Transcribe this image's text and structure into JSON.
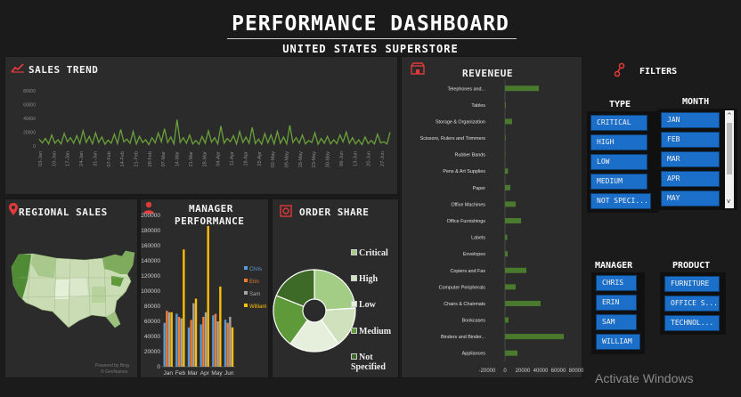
{
  "header": {
    "title": "PERFORMANCE DASHBOARD",
    "subtitle": "UNITED STATES SUPERSTORE"
  },
  "sales_trend": {
    "title": "SALES TREND",
    "y_ticks": [
      "80000",
      "60000",
      "40000",
      "20000",
      "0"
    ],
    "x_ticks": [
      "03-Jan",
      "10-Jan",
      "17-Jan",
      "24-Jan",
      "31-Jan",
      "07-Feb",
      "14-Feb",
      "21-Feb",
      "28-Feb",
      "07-Mar",
      "14-Mar",
      "21-Mar",
      "28-Mar",
      "04-Apr",
      "11-Apr",
      "18-Apr",
      "25-Apr",
      "02-May",
      "09-May",
      "16-May",
      "23-May",
      "30-May",
      "06-Jun",
      "13-Jun",
      "20-Jun",
      "27-Jun"
    ],
    "color": "#6aa03a"
  },
  "regional_sales": {
    "title": "REGIONAL SALES",
    "credit": "Powered by Bing\n© GeoNames"
  },
  "manager_performance": {
    "title_line1": "MANAGER",
    "title_line2": "PERFORMANCE"
  },
  "order_share": {
    "title": "ORDER SHARE",
    "legend": [
      "Critical",
      "High",
      "Low",
      "Medium",
      "Not Specified"
    ]
  },
  "revenue": {
    "title": "REVENEUE",
    "x_ticks": [
      "-20000",
      "0",
      "20000",
      "40000",
      "60000",
      "80000"
    ],
    "bar_color": "#4a7a2e"
  },
  "filters": {
    "title": "FILTERS",
    "type": {
      "title": "TYPE",
      "items": [
        "CRITICAL",
        "HIGH",
        "LOW",
        "MEDIUM",
        "NOT SPECI..."
      ]
    },
    "month": {
      "title": "MONTH",
      "items": [
        "JAN",
        "FEB",
        "MAR",
        "APR",
        "MAY"
      ]
    },
    "manager": {
      "title": "MANAGER",
      "items": [
        "CHRIS",
        "ERIN",
        "SAM",
        "WILLIAM"
      ]
    },
    "product": {
      "title": "PRODUCT",
      "items": [
        "FURNITURE",
        "OFFICE S...",
        "TECHNOL..."
      ]
    }
  },
  "watermark": "Activate Windows",
  "chart_data": [
    {
      "type": "line",
      "title": "SALES TREND",
      "ylim": [
        0,
        80000
      ],
      "x_range": [
        "03-Jan",
        "27-Jun"
      ],
      "series": [
        {
          "values": [
            10000,
            4500,
            11000,
            3000,
            16000,
            4000,
            9000,
            3000,
            18000,
            6000,
            12000,
            4000,
            15000,
            3500,
            22000,
            5000,
            14000,
            3000,
            19000,
            5000,
            13000,
            2500,
            8500,
            4000,
            17000,
            3500,
            24000,
            6000,
            10000,
            4000,
            21000,
            3000,
            14000,
            5000,
            9000,
            2000,
            12000,
            4500,
            19000,
            6000,
            25000,
            5000,
            13000,
            3000,
            38000,
            5000,
            12000,
            4000,
            16000,
            3000,
            8000,
            2500,
            14000,
            4000,
            22000,
            5500,
            12000,
            3000,
            29000,
            4000,
            11000,
            6000,
            15000,
            3000,
            21000,
            5000,
            13000,
            4000,
            27000,
            3500,
            10000,
            2500,
            18000,
            4500,
            16000,
            3000,
            21000,
            4000,
            13000,
            3000,
            30000,
            5000,
            12000,
            4000,
            16000,
            3000,
            8000,
            5000,
            19000,
            2500,
            11000,
            4000,
            14000,
            3000,
            9000,
            3500,
            16000,
            6000,
            20000,
            4000,
            12000,
            3000,
            9000,
            2000,
            13000,
            3500,
            8000,
            3000,
            17000,
            4500,
            6000,
            3000,
            20000
          ]
        }
      ]
    },
    {
      "type": "bar",
      "title": "MANAGER PERFORMANCE",
      "categories": [
        "Jan",
        "Feb",
        "Mar",
        "Apr",
        "May",
        "Jun"
      ],
      "ylim": [
        0,
        200000
      ],
      "y_ticks": [
        0,
        20000,
        40000,
        60000,
        80000,
        100000,
        120000,
        140000,
        160000,
        180000,
        200000
      ],
      "series": [
        {
          "name": "Chris",
          "color": "#5b9bd5",
          "values": [
            58000,
            70000,
            52000,
            56000,
            68000,
            62000
          ]
        },
        {
          "name": "Erin",
          "color": "#ed7d31",
          "values": [
            74000,
            66000,
            62000,
            66000,
            70000,
            58000
          ]
        },
        {
          "name": "Sam",
          "color": "#a5a5a5",
          "values": [
            72000,
            64000,
            84000,
            72000,
            60000,
            66000
          ]
        },
        {
          "name": "William",
          "color": "#ffc000",
          "values": [
            72000,
            155000,
            90000,
            186000,
            106000,
            52000
          ]
        }
      ]
    },
    {
      "type": "pie",
      "title": "ORDER SHARE",
      "series": [
        {
          "values": [
            24,
            16,
            20,
            21,
            19
          ]
        }
      ],
      "categories": [
        "Critical",
        "High",
        "Low",
        "Medium",
        "Not Specified"
      ],
      "colors": [
        "#a3cc85",
        "#cfe2bd",
        "#e6efdc",
        "#5f9a3a",
        "#3d6a26"
      ]
    },
    {
      "type": "bar",
      "orientation": "horizontal",
      "title": "REVENEUE",
      "xlim": [
        -20000,
        80000
      ],
      "categories": [
        "Telephones and...",
        "Tables",
        "Storage & Organization",
        "Scissors, Rulers and Trimmers",
        "Rubber Bands",
        "Pens & Art Supplies",
        "Paper",
        "Office Machines",
        "Office Furnishings",
        "Labels",
        "Envelopes",
        "Copiers and Fax",
        "Computer Peripherals",
        "Chairs & Chairmats",
        "Bookcases",
        "Binders and Binder...",
        "Appliances"
      ],
      "values": [
        38000,
        1000,
        8000,
        800,
        500,
        3500,
        6000,
        12000,
        18000,
        2500,
        3000,
        24000,
        12000,
        40000,
        4000,
        66000,
        14000
      ]
    }
  ]
}
